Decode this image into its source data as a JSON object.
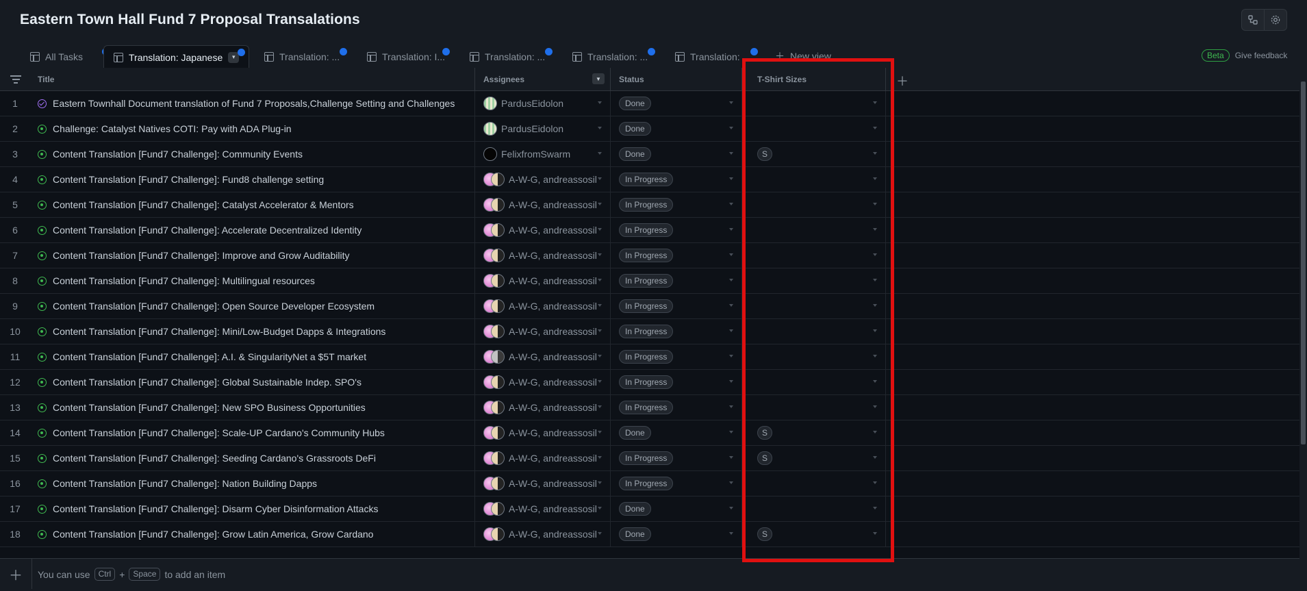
{
  "header": {
    "title": "Eastern Town Hall Fund 7 Proposal Transalations"
  },
  "tabs": [
    {
      "label": "All Tasks"
    },
    {
      "label": "Translation: Japanese"
    },
    {
      "label": "Translation: ..."
    },
    {
      "label": "Translation: I..."
    },
    {
      "label": "Translation: ..."
    },
    {
      "label": "Translation: ..."
    },
    {
      "label": "Translation: ..."
    }
  ],
  "new_view_label": "New view",
  "beta_label": "Beta",
  "feedback_label": "Give feedback",
  "columns": {
    "title": "Title",
    "assignees": "Assignees",
    "status": "Status",
    "tshirt": "T-Shirt Sizes"
  },
  "rows": [
    {
      "num": "1",
      "title": "Eastern Townhall Document translation of Fund 7 Proposals,Challenge Setting and Challenges",
      "assignees": "PardusEidolon",
      "status": "Done",
      "size": ""
    },
    {
      "num": "2",
      "title": "Challenge: Catalyst Natives COTI: Pay with ADA Plug-in",
      "assignees": "PardusEidolon",
      "status": "Done",
      "size": ""
    },
    {
      "num": "3",
      "title": "Content Translation [Fund7 Challenge]: Community Events",
      "assignees": "FelixfromSwarm",
      "status": "Done",
      "size": "S"
    },
    {
      "num": "4",
      "title": "Content Translation [Fund7 Challenge]: Fund8 challenge setting",
      "assignees": "A-W-G, andreassosil",
      "status": "In Progress",
      "size": ""
    },
    {
      "num": "5",
      "title": "Content Translation [Fund7 Challenge]: Catalyst Accelerator & Mentors",
      "assignees": "A-W-G, andreassosil",
      "status": "In Progress",
      "size": ""
    },
    {
      "num": "6",
      "title": "Content Translation [Fund7 Challenge]: Accelerate Decentralized Identity",
      "assignees": "A-W-G, andreassosil",
      "status": "In Progress",
      "size": ""
    },
    {
      "num": "7",
      "title": "Content Translation [Fund7 Challenge]: Improve and Grow Auditability",
      "assignees": "A-W-G, andreassosil",
      "status": "In Progress",
      "size": ""
    },
    {
      "num": "8",
      "title": "Content Translation [Fund7 Challenge]: Multilingual resources",
      "assignees": "A-W-G, andreassosil",
      "status": "In Progress",
      "size": ""
    },
    {
      "num": "9",
      "title": "Content Translation [Fund7 Challenge]: Open Source Developer Ecosystem",
      "assignees": "A-W-G, andreassosil",
      "status": "In Progress",
      "size": ""
    },
    {
      "num": "10",
      "title": "Content Translation [Fund7 Challenge]: Mini/Low-Budget Dapps & Integrations",
      "assignees": "A-W-G, andreassosil",
      "status": "In Progress",
      "size": ""
    },
    {
      "num": "11",
      "title": "Content Translation [Fund7 Challenge]: A.I. & SingularityNet a $5T market",
      "assignees": "A-W-G, andreassosil",
      "status": "In Progress",
      "size": ""
    },
    {
      "num": "12",
      "title": "Content Translation [Fund7 Challenge]: Global Sustainable Indep. SPO's",
      "assignees": "A-W-G, andreassosil",
      "status": "In Progress",
      "size": ""
    },
    {
      "num": "13",
      "title": "Content Translation [Fund7 Challenge]: New SPO Business Opportunities",
      "assignees": "A-W-G, andreassosil",
      "status": "In Progress",
      "size": ""
    },
    {
      "num": "14",
      "title": "Content Translation [Fund7 Challenge]: Scale-UP Cardano's Community Hubs",
      "assignees": "A-W-G, andreassosil",
      "status": "Done",
      "size": "S"
    },
    {
      "num": "15",
      "title": "Content Translation [Fund7 Challenge]: Seeding Cardano's Grassroots DeFi",
      "assignees": "A-W-G, andreassosil",
      "status": "In Progress",
      "size": "S"
    },
    {
      "num": "16",
      "title": "Content Translation [Fund7 Challenge]: Nation Building Dapps",
      "assignees": "A-W-G, andreassosil",
      "status": "In Progress",
      "size": ""
    },
    {
      "num": "17",
      "title": "Content Translation [Fund7 Challenge]: Disarm Cyber Disinformation Attacks",
      "assignees": "A-W-G, andreassosil",
      "status": "Done",
      "size": ""
    },
    {
      "num": "18",
      "title": "Content Translation [Fund7 Challenge]: Grow Latin America, Grow Cardano",
      "assignees": "A-W-G, andreassosil",
      "status": "Done",
      "size": "S"
    }
  ],
  "footer": {
    "hint_prefix": "You can use",
    "key1": "Ctrl",
    "plus": "+",
    "key2": "Space",
    "hint_suffix": "to add an item"
  },
  "colors": {
    "highlight": "#e01010",
    "accent_dot": "#1f6feb",
    "open_icon": "#3fb950",
    "done_icon": "#a371f7"
  }
}
